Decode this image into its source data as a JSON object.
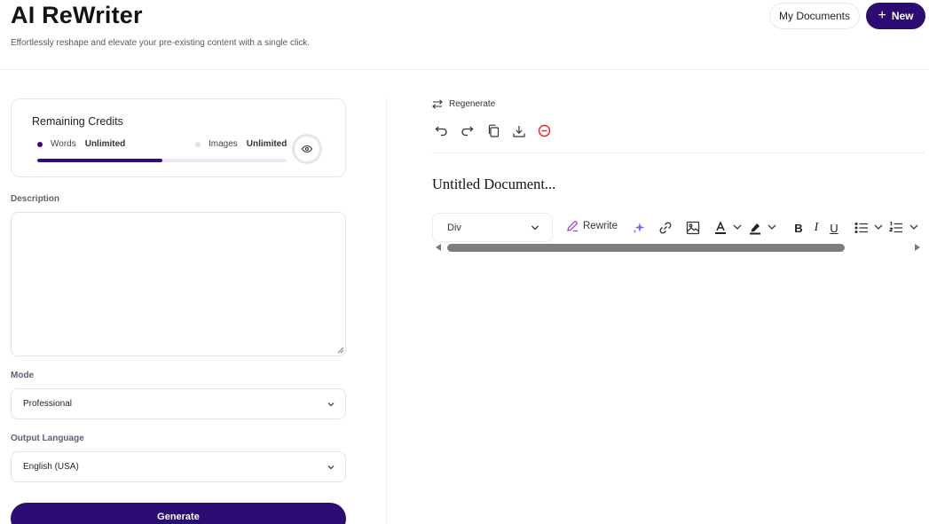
{
  "header": {
    "title": "AI ReWriter",
    "subtitle": "Effortlessly reshape and elevate your pre-existing content with a single click.",
    "my_documents_label": "My Documents",
    "new_label": "New"
  },
  "credits": {
    "title": "Remaining Credits",
    "words_label": "Words",
    "words_value": "Unlimited",
    "images_label": "Images",
    "images_value": "Unlimited",
    "usage_fraction": 0.5,
    "colors": {
      "words_dot": "#350b7c",
      "images_dot": "#e4dcf5",
      "track": "#ece6f7",
      "fill": "#350b7c"
    }
  },
  "form": {
    "description_label": "Description",
    "description_value": "",
    "mode_label": "Mode",
    "mode_value": "Professional",
    "language_label": "Output Language",
    "language_value": "English (USA)",
    "generate_label": "Generate"
  },
  "editor": {
    "regenerate_label": "Regenerate",
    "actions": [
      "undo-icon",
      "redo-icon",
      "copy-icon",
      "download-icon",
      "delete-icon"
    ],
    "document_title": "Untitled Document...",
    "block_type": "Div",
    "rewrite_label": "Rewrite",
    "format_icons": [
      "sparkle-icon",
      "link-icon",
      "image-icon",
      "text-color-icon",
      "highlight-icon",
      "bold-icon",
      "italic-icon",
      "underline-icon",
      "bullet-list-icon",
      "numbered-list-icon"
    ]
  },
  "colors": {
    "accent": "#2c0c73",
    "delete_red": "#e02424",
    "rewrite_purple": "#9b3fc6",
    "sparkle": "#6d6be8"
  }
}
